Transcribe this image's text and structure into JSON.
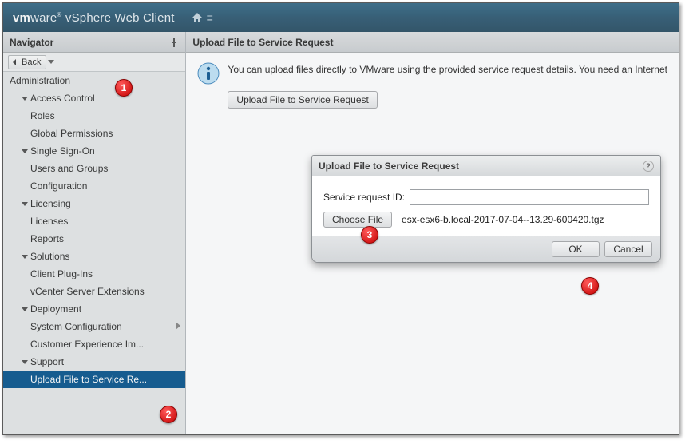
{
  "header": {
    "product_html": "vmware® vSphere Web Client"
  },
  "navigator": {
    "title": "Navigator",
    "back": "Back",
    "root": "Administration",
    "groups": [
      {
        "label": "Access Control",
        "items": [
          "Roles",
          "Global Permissions"
        ]
      },
      {
        "label": "Single Sign-On",
        "items": [
          "Users and Groups",
          "Configuration"
        ]
      },
      {
        "label": "Licensing",
        "items": [
          "Licenses",
          "Reports"
        ]
      },
      {
        "label": "Solutions",
        "items": [
          "Client Plug-Ins",
          "vCenter Server Extensions"
        ]
      },
      {
        "label": "Deployment",
        "items": [
          "System Configuration",
          "Customer Experience Im..."
        ]
      },
      {
        "label": "Support",
        "items": [
          "Upload File to Service Re..."
        ]
      }
    ],
    "system_config_has_chevron": true,
    "selected_item": "Upload File to Service Re..."
  },
  "main": {
    "title": "Upload File to Service Request",
    "info_text": "You can upload files directly to VMware using the provided service request details. You need an Internet",
    "upload_button": "Upload File to Service Request"
  },
  "dialog": {
    "title": "Upload File to Service Request",
    "sr_label": "Service request ID:",
    "sr_value": "",
    "choose_file": "Choose File",
    "filename": "esx-esx6-b.local-2017-07-04--13.29-600420.tgz",
    "ok": "OK",
    "cancel": "Cancel",
    "help": "?"
  },
  "markers": {
    "m1": "1",
    "m2": "2",
    "m3": "3",
    "m4": "4"
  }
}
